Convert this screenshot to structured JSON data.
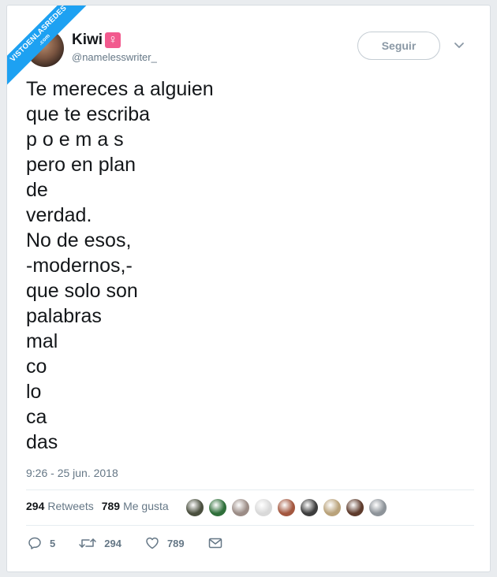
{
  "watermark": {
    "line1": "VISTOENLASREDES",
    "line2": ".com"
  },
  "author": {
    "display_name": "Kiwi",
    "gender_icon": "♀",
    "handle": "@namelesswriter_"
  },
  "follow_label": "Seguir",
  "tweet": {
    "text": "Te mereces a alguien\nque te escriba\np o e m a s\npero en plan\nde\nverdad.\nNo de esos,\n-modernos,-\nque solo son\npalabras\nmal\nco\nlo\nca\ndas",
    "timestamp": "9:26 - 25 jun. 2018"
  },
  "stats": {
    "retweets_count": "294",
    "retweets_label": "Retweets",
    "likes_count": "789",
    "likes_label": "Me gusta"
  },
  "liker_colors": [
    "#4a4f3e",
    "#2f6f3a",
    "#9b8c86",
    "#d9d9d9",
    "#a3573f",
    "#3d3d3d",
    "#b9a27a",
    "#5e3b2c",
    "#8d9399"
  ],
  "actions": {
    "reply_count": "5",
    "retweet_count": "294",
    "like_count": "789"
  },
  "colors": {
    "accent": "#1da1f2",
    "text": "#14171a",
    "muted": "#657786"
  }
}
